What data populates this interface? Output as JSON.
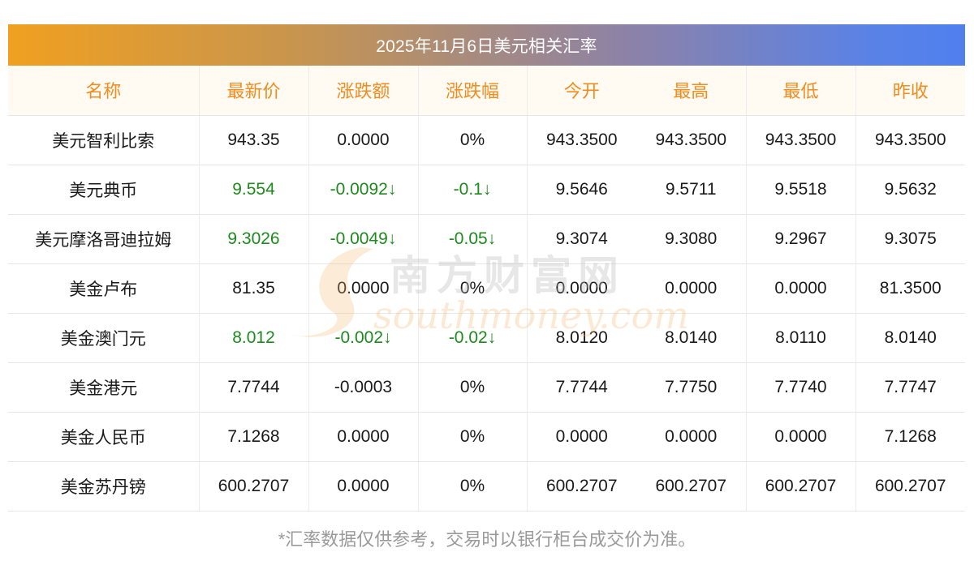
{
  "title": "2025年11月6日美元相关汇率",
  "columns": [
    "名称",
    "最新价",
    "涨跌额",
    "涨跌幅",
    "今开",
    "最高",
    "最低",
    "昨收"
  ],
  "rows": [
    {
      "name": "美元智利比索",
      "latest": "943.35",
      "change": "0.0000",
      "pct": "0%",
      "open": "943.3500",
      "high": "943.3500",
      "low": "943.3500",
      "prev": "943.3500",
      "down": false
    },
    {
      "name": "美元典币",
      "latest": "9.554",
      "change": "-0.0092↓",
      "pct": "-0.1↓",
      "open": "9.5646",
      "high": "9.5711",
      "low": "9.5518",
      "prev": "9.5632",
      "down": true
    },
    {
      "name": "美元摩洛哥迪拉姆",
      "latest": "9.3026",
      "change": "-0.0049↓",
      "pct": "-0.05↓",
      "open": "9.3074",
      "high": "9.3080",
      "low": "9.2967",
      "prev": "9.3075",
      "down": true
    },
    {
      "name": "美金卢布",
      "latest": "81.35",
      "change": "0.0000",
      "pct": "0%",
      "open": "0.0000",
      "high": "0.0000",
      "low": "0.0000",
      "prev": "81.3500",
      "down": false
    },
    {
      "name": "美金澳门元",
      "latest": "8.012",
      "change": "-0.002↓",
      "pct": "-0.02↓",
      "open": "8.0120",
      "high": "8.0140",
      "low": "8.0110",
      "prev": "8.0140",
      "down": true
    },
    {
      "name": "美金港元",
      "latest": "7.7744",
      "change": "-0.0003",
      "pct": "0%",
      "open": "7.7744",
      "high": "7.7750",
      "low": "7.7740",
      "prev": "7.7747",
      "down": false
    },
    {
      "name": "美金人民币",
      "latest": "7.1268",
      "change": "0.0000",
      "pct": "0%",
      "open": "0.0000",
      "high": "0.0000",
      "low": "0.0000",
      "prev": "7.1268",
      "down": false
    },
    {
      "name": "美金苏丹镑",
      "latest": "600.2707",
      "change": "0.0000",
      "pct": "0%",
      "open": "600.2707",
      "high": "600.2707",
      "low": "600.2707",
      "prev": "600.2707",
      "down": false
    }
  ],
  "footnote": "*汇率数据仅供参考，交易时以银行柜台成交价为准。",
  "watermark": {
    "cn": "南方财富网",
    "en": "southmoney.com"
  },
  "colors": {
    "header_text": "#f28c1e",
    "down": "#1e8a1e",
    "title_gradient_start": "#f0a020",
    "title_gradient_end": "#4f80ee"
  }
}
